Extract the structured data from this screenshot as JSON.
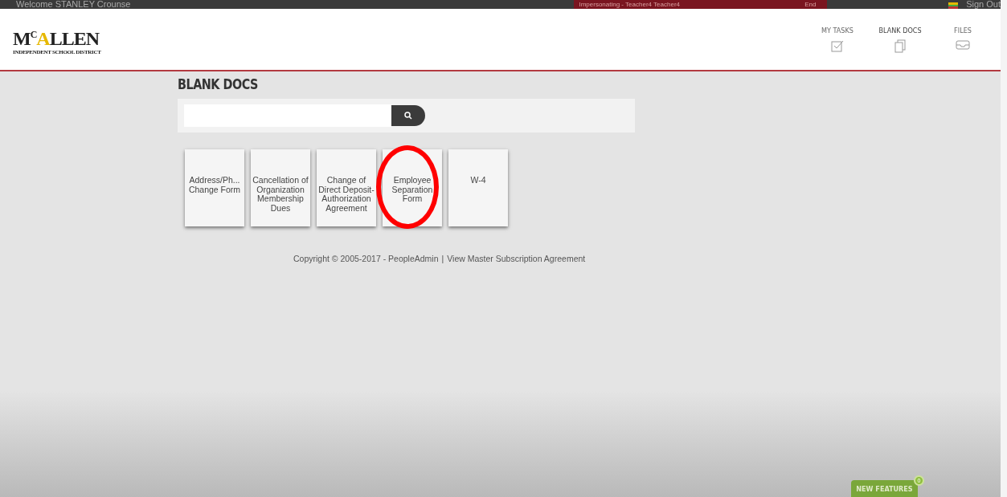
{
  "top_bar": {
    "welcome": "Welcome STANLEY Crounse",
    "impersonating": "Impersonating - Teacher4 Teacher4",
    "end": "End",
    "sign_out": "Sign Out"
  },
  "logo": {
    "lead": "M",
    "raised": "C",
    "accent": "A",
    "tail": "LLEN",
    "subtitle": "INDEPENDENT SCHOOL DISTRICT"
  },
  "nav": [
    {
      "label": "MY TASKS",
      "kind": "tasks",
      "selected": false
    },
    {
      "label": "BLANK DOCS",
      "kind": "docs",
      "selected": true
    },
    {
      "label": "FILES",
      "kind": "files",
      "selected": false
    }
  ],
  "page_title": "BLANK DOCS",
  "documents": [
    {
      "title": "Address/Ph... Change Form",
      "circled": false
    },
    {
      "title": "Cancellation of Organization Membership Dues",
      "circled": false
    },
    {
      "title": "Change of Direct Deposit-Authorization Agreement",
      "circled": false
    },
    {
      "title": "Employee Separation Form",
      "circled": true
    },
    {
      "title": "W-4",
      "circled": false
    }
  ],
  "footer": {
    "copyright": "Copyright © 2005-2017 - PeopleAdmin",
    "separator": "|",
    "link": "View Master Subscription Agreement"
  },
  "new_features": {
    "label": "NEW FEATURES",
    "count": "0"
  }
}
